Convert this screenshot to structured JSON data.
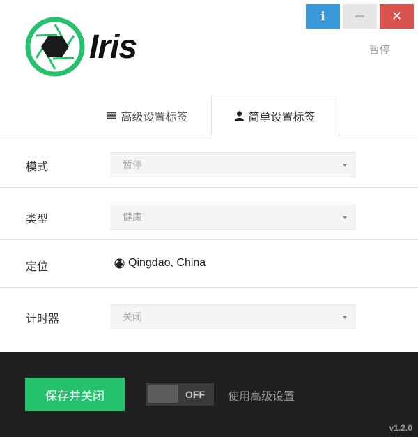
{
  "window": {
    "info_label": "i",
    "close_label": "✕"
  },
  "header": {
    "logo_text": "Iris",
    "status": "暂停"
  },
  "tabs": [
    {
      "label": "高级设置标签",
      "icon": "list-icon"
    },
    {
      "label": "简单设置标签",
      "icon": "user-icon",
      "active": true
    }
  ],
  "settings": {
    "mode": {
      "label": "模式",
      "value": "暂停"
    },
    "type": {
      "label": "类型",
      "value": "健康"
    },
    "location": {
      "label": "定位",
      "value": "Qingdao, China",
      "icon": "globe-icon"
    },
    "timer": {
      "label": "计时器",
      "value": "关闭"
    }
  },
  "footer": {
    "save_label": "保存并关闭",
    "toggle_state": "OFF",
    "advanced_label": "使用高级设置",
    "version": "v1.2.0"
  },
  "colors": {
    "accent_green": "#25c26e",
    "info_blue": "#3a9ad9",
    "close_red": "#d9534f",
    "footer_bg": "#1f1f1f"
  }
}
